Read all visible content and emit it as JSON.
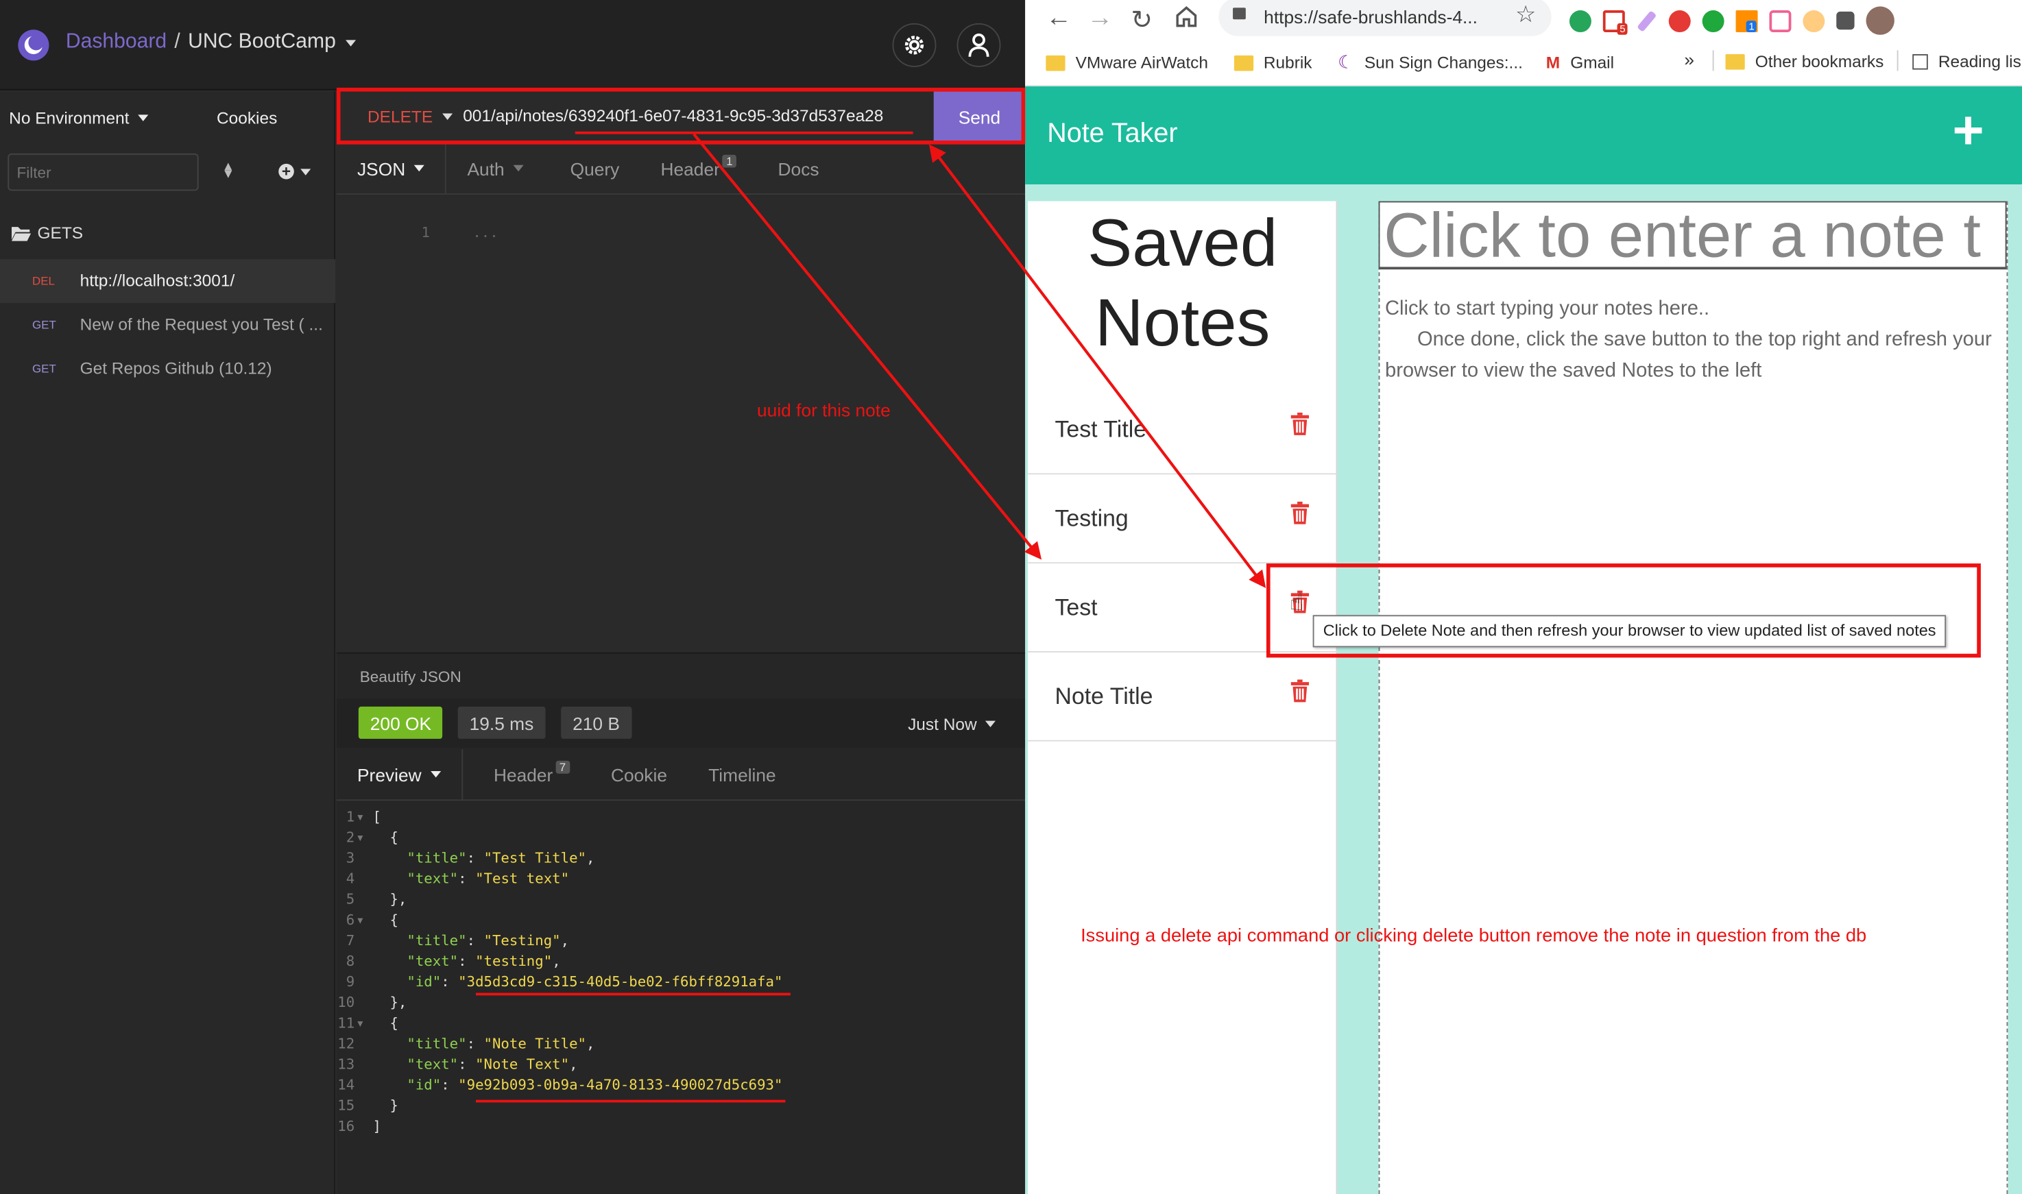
{
  "insomnia": {
    "breadcrumb": {
      "dashboard": "Dashboard",
      "sep": "/",
      "workspace": "UNC BootCamp"
    },
    "sidebar": {
      "environment": "No Environment",
      "cookies": "Cookies",
      "filter_placeholder": "Filter",
      "folder": "GETS",
      "items": [
        {
          "method": "DEL",
          "label": "http://localhost:3001/"
        },
        {
          "method": "GET",
          "label": "New of the Request you Test ( ..."
        },
        {
          "method": "GET",
          "label": "Get Repos Github (10.12)"
        }
      ]
    },
    "request": {
      "method": "DELETE",
      "url_prefix": "001/api/notes/",
      "url_id": "639240f1-6e07-4831-9c95-3d37d537ea28",
      "send": "Send",
      "tabs": [
        {
          "label": "JSON"
        },
        {
          "label": "Auth"
        },
        {
          "label": "Query"
        },
        {
          "label": "Header",
          "badge": "1"
        },
        {
          "label": "Docs"
        }
      ],
      "body_line": "1",
      "body_text": "..."
    },
    "beautify": "Beautify JSON",
    "response": {
      "status": "200 OK",
      "time": "19.5 ms",
      "size": "210 B",
      "when": "Just Now",
      "tabs": [
        {
          "label": "Preview"
        },
        {
          "label": "Header",
          "badge": "7"
        },
        {
          "label": "Cookie"
        },
        {
          "label": "Timeline"
        }
      ]
    }
  },
  "json_lines": [
    {
      "n": "1",
      "fold": "▾",
      "parts": [
        [
          "p",
          "["
        ]
      ]
    },
    {
      "n": "2",
      "fold": "▾",
      "parts": [
        [
          "p",
          "  {"
        ]
      ]
    },
    {
      "n": "3",
      "fold": "",
      "parts": [
        [
          "p",
          "    "
        ],
        [
          "k",
          "\"title\""
        ],
        [
          "p",
          ": "
        ],
        [
          "s",
          "\"Test Title\""
        ],
        [
          "p",
          ","
        ]
      ]
    },
    {
      "n": "4",
      "fold": "",
      "parts": [
        [
          "p",
          "    "
        ],
        [
          "k",
          "\"text\""
        ],
        [
          "p",
          ": "
        ],
        [
          "s",
          "\"Test text\""
        ]
      ]
    },
    {
      "n": "5",
      "fold": "",
      "parts": [
        [
          "p",
          "  },"
        ]
      ]
    },
    {
      "n": "6",
      "fold": "▾",
      "parts": [
        [
          "p",
          "  {"
        ]
      ]
    },
    {
      "n": "7",
      "fold": "",
      "parts": [
        [
          "p",
          "    "
        ],
        [
          "k",
          "\"title\""
        ],
        [
          "p",
          ": "
        ],
        [
          "s",
          "\"Testing\""
        ],
        [
          "p",
          ","
        ]
      ]
    },
    {
      "n": "8",
      "fold": "",
      "parts": [
        [
          "p",
          "    "
        ],
        [
          "k",
          "\"text\""
        ],
        [
          "p",
          ": "
        ],
        [
          "s",
          "\"testing\""
        ],
        [
          "p",
          ","
        ]
      ]
    },
    {
      "n": "9",
      "fold": "",
      "parts": [
        [
          "p",
          "    "
        ],
        [
          "k",
          "\"id\""
        ],
        [
          "p",
          ": "
        ],
        [
          "s",
          "\"3d5d3cd9-c315-40d5-be02-f6bff8291afa\""
        ]
      ]
    },
    {
      "n": "10",
      "fold": "",
      "parts": [
        [
          "p",
          "  },"
        ]
      ]
    },
    {
      "n": "11",
      "fold": "▾",
      "parts": [
        [
          "p",
          "  {"
        ]
      ]
    },
    {
      "n": "12",
      "fold": "",
      "parts": [
        [
          "p",
          "    "
        ],
        [
          "k",
          "\"title\""
        ],
        [
          "p",
          ": "
        ],
        [
          "s",
          "\"Note Title\""
        ],
        [
          "p",
          ","
        ]
      ]
    },
    {
      "n": "13",
      "fold": "",
      "parts": [
        [
          "p",
          "    "
        ],
        [
          "k",
          "\"text\""
        ],
        [
          "p",
          ": "
        ],
        [
          "s",
          "\"Note Text\""
        ],
        [
          "p",
          ","
        ]
      ]
    },
    {
      "n": "14",
      "fold": "",
      "parts": [
        [
          "p",
          "    "
        ],
        [
          "k",
          "\"id\""
        ],
        [
          "p",
          ": "
        ],
        [
          "s",
          "\"9e92b093-0b9a-4a70-8133-490027d5c693\""
        ]
      ]
    },
    {
      "n": "15",
      "fold": "",
      "parts": [
        [
          "p",
          "  }"
        ]
      ]
    },
    {
      "n": "16",
      "fold": "",
      "parts": [
        [
          "p",
          "]"
        ]
      ]
    }
  ],
  "browser": {
    "url": "https://safe-brushlands-4...",
    "bookmarks": [
      "VMware AirWatch",
      "Rubrik",
      "Sun Sign Changes:...",
      "Gmail"
    ],
    "more": "»",
    "other_bookmarks": "Other bookmarks",
    "reading_list": "Reading lis",
    "extension_badges": {
      "gmail": "5",
      "flag": "1"
    }
  },
  "app": {
    "title": "Note Taker",
    "add_icon": "+",
    "saved_heading_1": "Saved",
    "saved_heading_2": "Notes",
    "notes": [
      {
        "title": "Test Title"
      },
      {
        "title": "Testing"
      },
      {
        "title": "Test"
      },
      {
        "title": "Note Title"
      }
    ],
    "title_placeholder": "Click to enter a note t",
    "body_line1": "Click to start typing your notes here..",
    "body_line2": "Once done, click the save button to the top right and refresh your",
    "body_line3": "browser to view the saved Notes to the left",
    "tooltip": "Click to Delete Note and then refresh your browser to view updated list of saved notes"
  },
  "annotations": {
    "uuid_label": "uuid for this note",
    "bottom_note": "Issuing a delete api command or clicking delete button remove the note in question from the db",
    "color": "#e11111"
  },
  "colors": {
    "accent_purple": "#7d69cb",
    "teal": "#1abc9c",
    "teal_light": "#b3ebe0",
    "ok_green": "#75ba24",
    "delete_red": "#e14d43"
  }
}
